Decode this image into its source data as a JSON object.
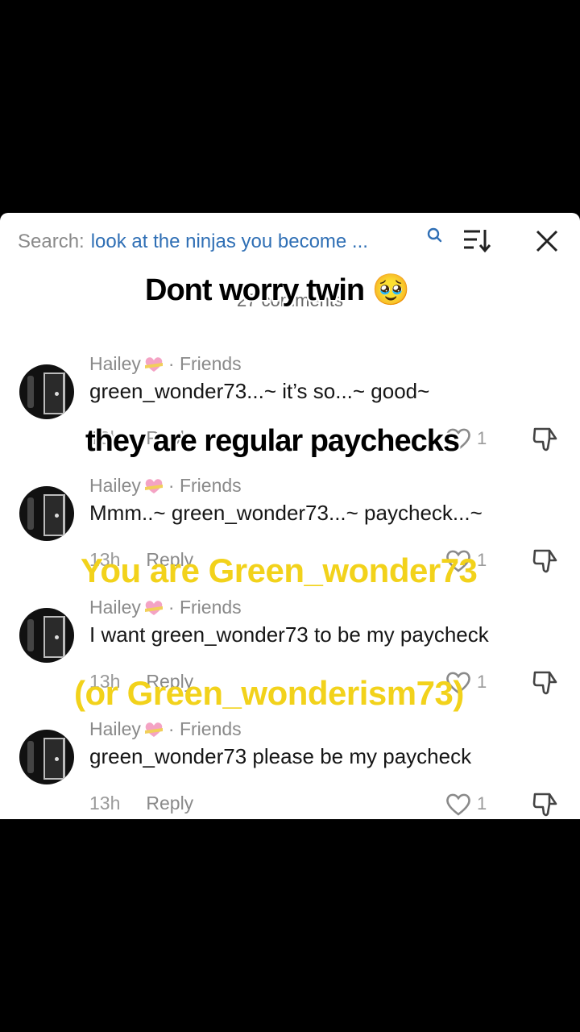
{
  "search": {
    "prefix": "Search:",
    "query": "look at the ninjas you become ..."
  },
  "comments_title": "27 comments",
  "captions": {
    "c1": "Dont worry twin",
    "c2": "they are regular paychecks",
    "c3": "You are Green_wonder73",
    "c4": "(or Green_wonderism73)",
    "emoji": "🥹"
  },
  "comments": [
    {
      "name": "Hailey",
      "relation": "· Friends",
      "text": "green_wonder73...~ it’s so...~ good~",
      "time": "13h",
      "reply": "Reply",
      "likes": "1"
    },
    {
      "name": "Hailey",
      "relation": "· Friends",
      "text": "Mmm..~ green_wonder73...~ paycheck...~",
      "time": "13h",
      "reply": "Reply",
      "likes": "1"
    },
    {
      "name": "Hailey",
      "relation": "· Friends",
      "text": "I want green_wonder73 to be my paycheck",
      "time": "13h",
      "reply": "Reply",
      "likes": "1"
    },
    {
      "name": "Hailey",
      "relation": "· Friends",
      "text": "green_wonder73 please be my paycheck",
      "time": "13h",
      "reply": "Reply",
      "likes": "1"
    }
  ],
  "icons": {
    "heart_badge": "heart-ribbon-icon",
    "like": "heart-outline-icon",
    "dislike": "thumbs-down-icon",
    "sort": "sort-icon",
    "close": "close-icon",
    "search": "search-icon"
  },
  "colors": {
    "search_query": "#2f6fb5",
    "caption_yellow": "#f2d21b"
  }
}
